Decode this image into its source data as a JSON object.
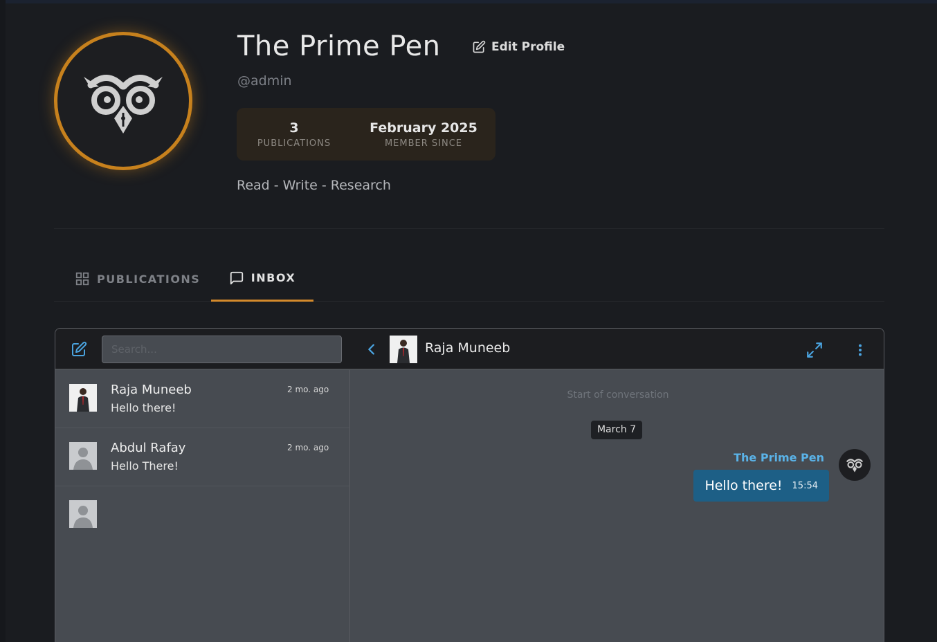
{
  "profile": {
    "name": "The Prime Pen",
    "handle": "@admin",
    "edit_label": "Edit Profile",
    "bio": "Read - Write - Research",
    "stats": [
      {
        "value": "3",
        "label": "PUBLICATIONS"
      },
      {
        "value": "February 2025",
        "label": "MEMBER SINCE"
      }
    ]
  },
  "tabs": [
    {
      "label": "PUBLICATIONS",
      "icon": "grid-icon",
      "active": false
    },
    {
      "label": "INBOX",
      "icon": "chat-bubble-icon",
      "active": true
    }
  ],
  "inbox": {
    "search_placeholder": "Search...",
    "conversations": [
      {
        "name": "Raja Muneeb",
        "preview": "Hello there!",
        "time": "2 mo. ago",
        "avatar": "photo"
      },
      {
        "name": "Abdul Rafay",
        "preview": "Hello There!",
        "time": "2 mo. ago",
        "avatar": "generic"
      },
      {
        "name": "",
        "preview": "",
        "time": "",
        "avatar": "generic"
      }
    ],
    "active_chat": {
      "name": "Raja Muneeb",
      "start_label": "Start of conversation",
      "date_label": "March 7",
      "messages": [
        {
          "sender": "The Prime Pen",
          "text": "Hello there!",
          "time": "15:54"
        }
      ]
    }
  },
  "colors": {
    "accent": "#d48a2c",
    "link_blue": "#5ab3e8",
    "bubble_blue": "#1d5f86",
    "background": "#1a1c20",
    "panel": "#474b51"
  }
}
